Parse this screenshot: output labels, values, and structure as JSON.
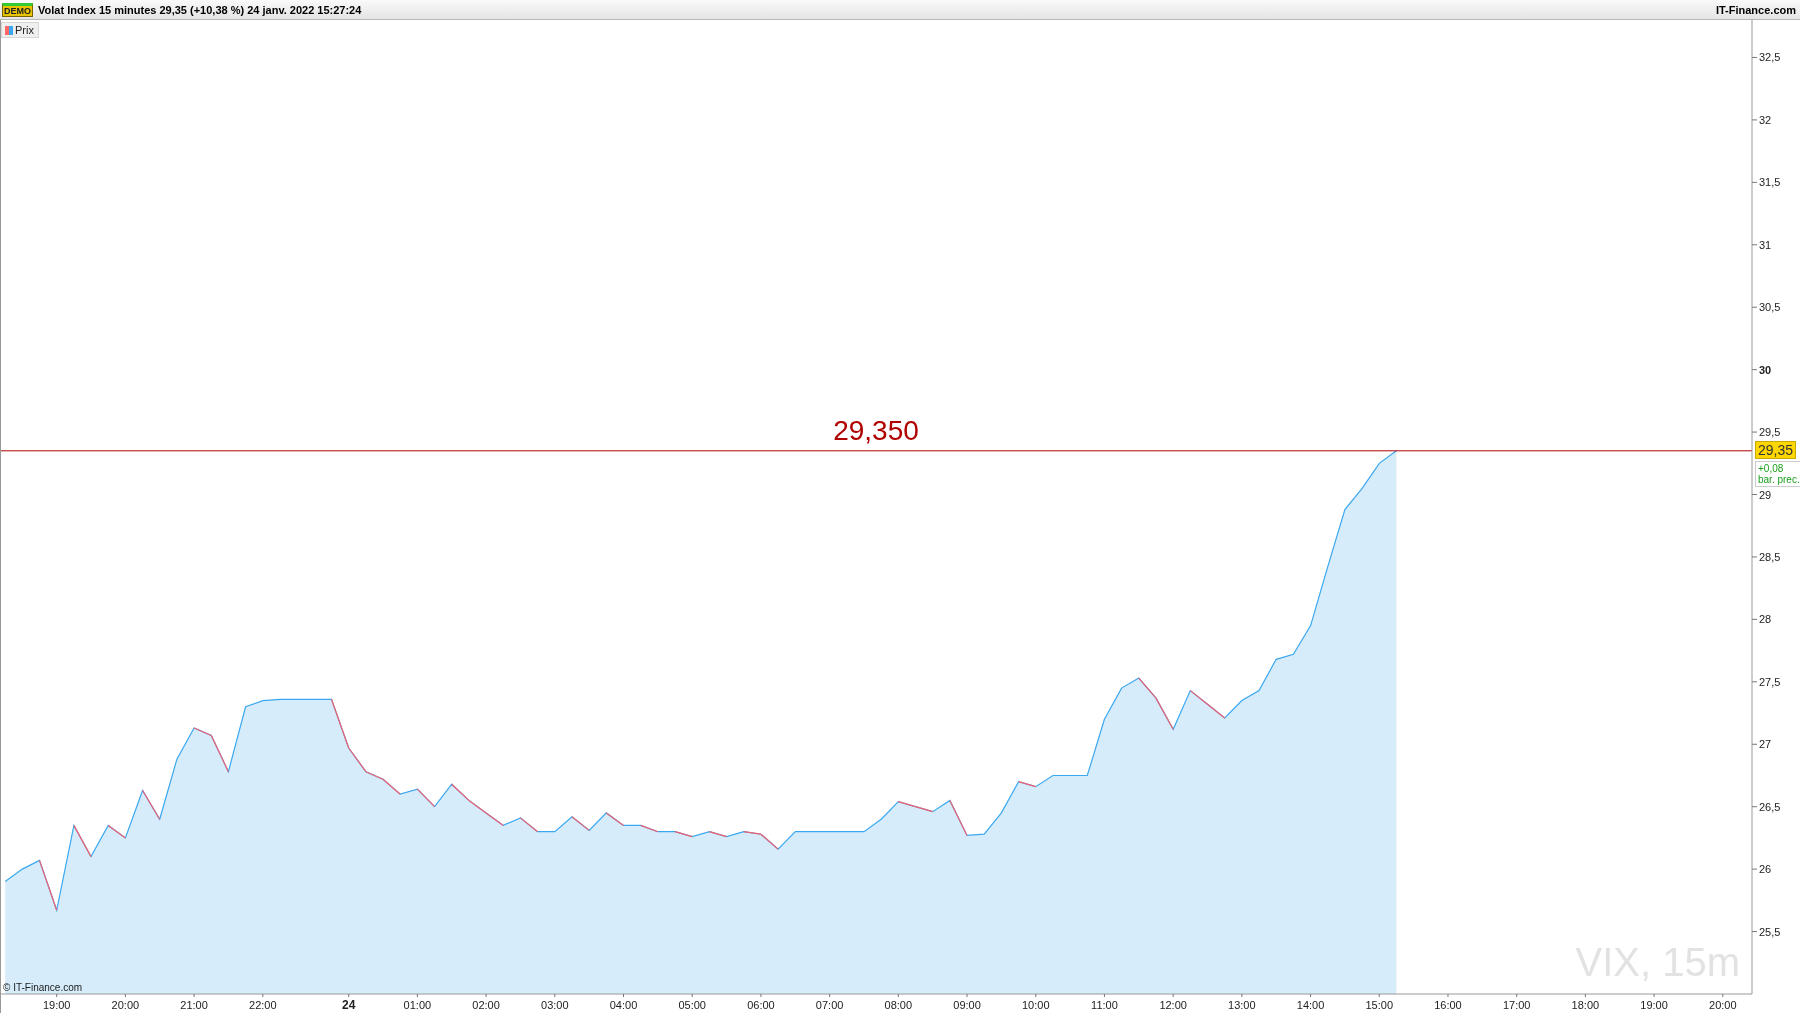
{
  "header": {
    "badge": "DEMO",
    "title": "Volat Index 15 minutes 29,35 (+10,38 %) 24 janv. 2022 15:27:24",
    "source": "IT-Finance.com"
  },
  "chart": {
    "price_line": {
      "axis_label": "29,35",
      "change": "+0,08",
      "change_note": "bar. prec."
    },
    "copyright": "© IT-Finance.com",
    "instrument_label": "VIX, 15m",
    "chart_data": {
      "type": "area",
      "categories": [
        null,
        null,
        null,
        "19:00",
        null,
        null,
        null,
        "20:00",
        null,
        null,
        null,
        "21:00",
        null,
        null,
        null,
        "22:00",
        null,
        null,
        null,
        null,
        "24",
        null,
        null,
        null,
        "01:00",
        null,
        null,
        null,
        "02:00",
        null,
        null,
        null,
        "03:00",
        null,
        null,
        null,
        "04:00",
        null,
        null,
        null,
        "05:00",
        null,
        null,
        null,
        "06:00",
        null,
        null,
        null,
        "07:00",
        null,
        null,
        null,
        "08:00",
        null,
        null,
        null,
        "09:00",
        null,
        null,
        null,
        "10:00",
        null,
        null,
        null,
        "11:00",
        null,
        null,
        null,
        "12:00",
        null,
        null,
        null,
        "13:00",
        null,
        null,
        null,
        "14:00",
        null,
        null,
        null,
        "15:00",
        null,
        null,
        null,
        "16:00",
        null,
        null,
        null,
        "17:00",
        null,
        null,
        null,
        "18:00",
        null,
        null,
        null,
        "19:00",
        null,
        null,
        null,
        "20:00",
        null
      ],
      "series": [
        {
          "name": "Prix",
          "color": "#3aa8f0",
          "values": [
            25.9,
            26.0,
            26.07,
            25.67,
            26.35,
            26.1,
            26.35,
            26.25,
            26.63,
            26.4,
            26.88,
            27.13,
            27.07,
            26.78,
            27.3,
            27.35,
            27.36,
            27.36,
            27.36,
            27.36,
            26.97,
            26.78,
            26.72,
            26.6,
            26.64,
            26.5,
            26.68,
            26.55,
            26.45,
            26.35,
            26.41,
            26.3,
            26.3,
            26.42,
            26.31,
            26.45,
            26.35,
            26.35,
            26.3,
            26.3,
            26.26,
            26.3,
            26.26,
            26.3,
            26.28,
            26.16,
            26.3,
            26.3,
            26.3,
            26.3,
            26.3,
            26.4,
            26.54,
            26.5,
            26.46,
            26.55,
            26.27,
            26.28,
            26.45,
            26.7,
            26.66,
            26.75,
            26.75,
            26.75,
            27.2,
            27.45,
            27.53,
            27.37,
            27.12,
            27.43,
            27.32,
            27.21,
            27.35,
            27.43,
            27.68,
            27.72,
            27.95,
            28.42,
            28.88,
            29.05,
            29.25,
            29.35,
            null,
            null,
            null,
            null,
            null,
            null,
            null,
            null,
            null,
            null,
            null,
            null,
            null,
            null,
            null,
            null,
            null,
            null,
            null,
            null
          ]
        }
      ],
      "ylim": [
        25.0,
        32.8
      ],
      "ref_lines": [
        {
          "axis": "y",
          "value": 29.35,
          "label": "29,350",
          "color": "#b00000"
        }
      ],
      "yticks": [
        {
          "value": 25.5,
          "label": "25,5"
        },
        {
          "value": 26,
          "label": "26"
        },
        {
          "value": 26.5,
          "label": "26,5"
        },
        {
          "value": 27,
          "label": "27"
        },
        {
          "value": 27.5,
          "label": "27,5"
        },
        {
          "value": 28,
          "label": "28"
        },
        {
          "value": 28.5,
          "label": "28,5"
        },
        {
          "value": 29,
          "label": "29"
        },
        {
          "value": 29.5,
          "label": "29,5"
        },
        {
          "value": 30,
          "label": "30"
        },
        {
          "value": 30.5,
          "label": "30,5"
        },
        {
          "value": 31,
          "label": "31"
        },
        {
          "value": 31.5,
          "label": "31,5"
        },
        {
          "value": 32,
          "label": "32"
        },
        {
          "value": 32.5,
          "label": "32,5"
        }
      ]
    }
  }
}
